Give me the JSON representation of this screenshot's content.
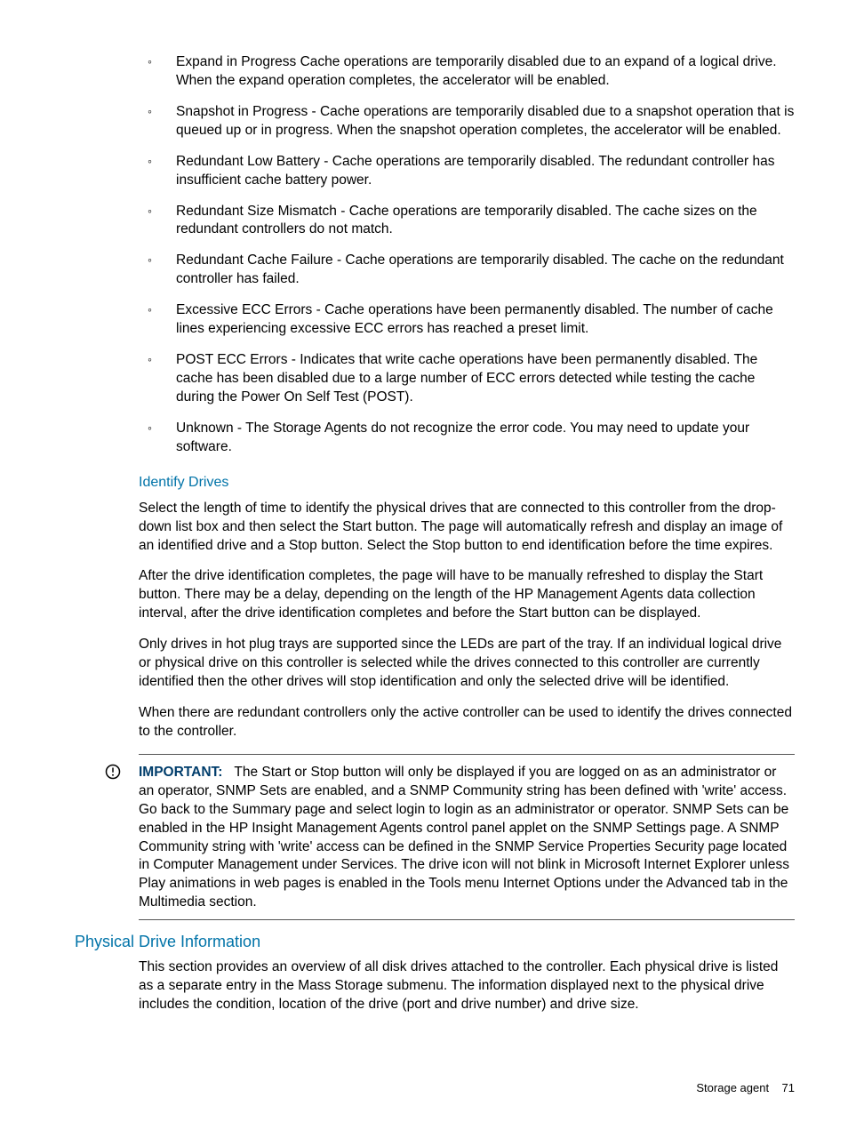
{
  "bullets": [
    "Expand in Progress Cache operations are temporarily disabled due to an expand of a logical drive. When the expand operation completes, the accelerator will be enabled.",
    "Snapshot in Progress - Cache operations are temporarily disabled due to a snapshot operation that is queued up or in progress. When the snapshot operation completes, the accelerator will be enabled.",
    "Redundant Low Battery - Cache operations are temporarily disabled. The redundant controller has insufficient cache battery power.",
    "Redundant Size Mismatch - Cache operations are temporarily disabled. The cache sizes on the redundant controllers do not match.",
    "Redundant Cache Failure - Cache operations are temporarily disabled. The cache on the redundant controller has failed.",
    "Excessive ECC Errors - Cache operations have been permanently disabled. The number of cache lines experiencing excessive ECC errors has reached a preset limit.",
    "POST ECC Errors - Indicates that write cache operations have been permanently disabled. The cache has been disabled due to a large number of ECC errors detected while testing the cache during the Power On Self Test (POST).",
    "Unknown - The Storage Agents do not recognize the error code. You may need to update your software."
  ],
  "identify": {
    "heading": "Identify Drives",
    "p1": "Select the length of time to identify the physical drives that are connected to this controller from the drop-down list box and then select the Start button. The page will automatically refresh and display an image of an identified drive and a Stop button. Select the Stop button to end identification before the time expires.",
    "p2": "After the drive identification completes, the page will have to be manually refreshed to display the Start button. There may be a delay, depending on the length of the HP Management Agents data collection interval, after the drive identification completes and before the Start button can be displayed.",
    "p3": "Only drives in hot plug trays are supported since the LEDs are part of the tray. If an individual logical drive or physical drive on this controller is selected while the drives connected to this controller are currently identified then the other drives will stop identification and only the selected drive will be identified.",
    "p4": "When there are redundant controllers only the active controller can be used to identify the drives connected to the controller."
  },
  "important": {
    "label": "IMPORTANT:",
    "text": "The Start or Stop button will only be displayed if you are logged on as an administrator or an operator, SNMP Sets are enabled, and a SNMP Community string has been defined with 'write' access. Go back to the Summary page and select login to login as an administrator or operator. SNMP Sets can be enabled in the HP Insight Management Agents control panel applet on the SNMP Settings page. A SNMP Community string with 'write' access can be defined in the SNMP Service Properties Security page located in Computer Management under Services. The drive icon will not blink in Microsoft Internet Explorer unless Play animations in web pages is enabled in the Tools menu Internet Options under the Advanced tab in the Multimedia section."
  },
  "physical": {
    "heading": "Physical Drive Information",
    "p1": "This section provides an overview of all disk drives attached to the controller. Each physical drive is listed as a separate entry in the Mass Storage submenu. The information displayed next to the physical drive includes the condition, location of the drive (port and drive number) and drive size."
  },
  "footer": {
    "section": "Storage agent",
    "page": "71"
  }
}
